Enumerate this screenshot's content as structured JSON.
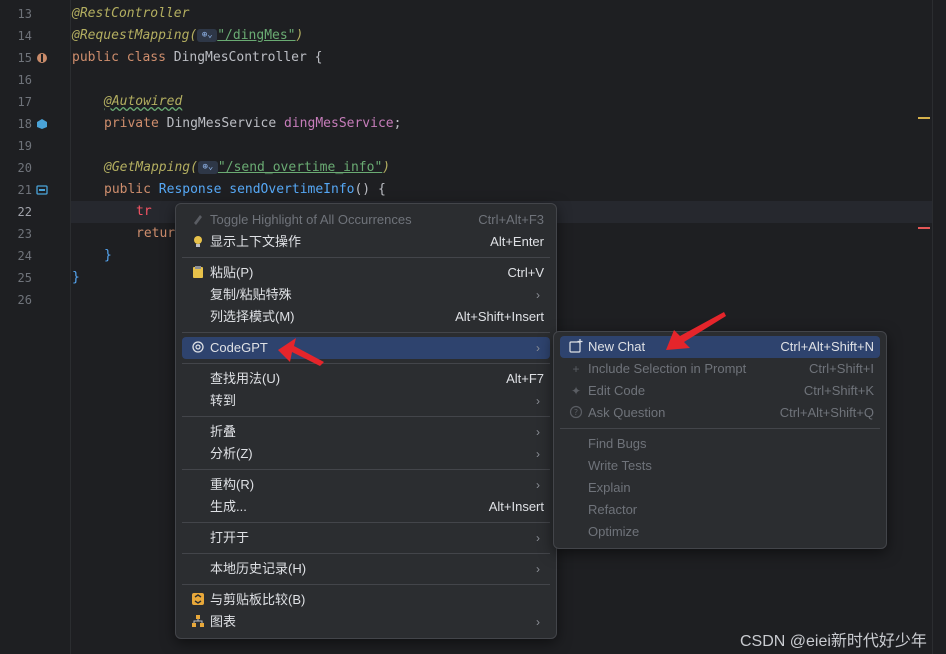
{
  "editor": {
    "line_numbers": [
      "13",
      "14",
      "15",
      "16",
      "17",
      "18",
      "19",
      "20",
      "21",
      "22",
      "23",
      "24",
      "25",
      "26"
    ],
    "code": {
      "l13_ann": "@RestController",
      "l14_ann": "@RequestMapping(",
      "l14_url": "\"/dingMes\"",
      "l14_close": ")",
      "l15_kw": "public class ",
      "l15_cls": "DingMesController {",
      "l17_ann": "@Autowired",
      "l18_kw": "private ",
      "l18_type": "DingMesService ",
      "l18_field": "dingMesService",
      "l18_end": ";",
      "l20_ann": "@GetMapping(",
      "l20_url": "\"/send_overtime_info\"",
      "l20_close": ")",
      "l21_kw": "public ",
      "l21_type": "Response ",
      "l21_fn": "sendOvertimeInfo",
      "l21_end": "() {",
      "l22_text": "tr",
      "l23_text": "retur",
      "l24_text": "}",
      "l25_text": "}"
    },
    "globe_icon_label": "⊕⌄"
  },
  "context_menu": {
    "items": [
      {
        "label": "Toggle Highlight of All Occurrences",
        "shortcut": "Ctrl+Alt+F3",
        "disabled": true
      },
      {
        "label": "显示上下文操作",
        "shortcut": "Alt+Enter",
        "icon": "bulb-icon"
      },
      {
        "label": "粘贴(P)",
        "shortcut": "Ctrl+V",
        "icon": "clipboard-icon"
      },
      {
        "label": "复制/粘贴特殊"
      },
      {
        "label": "列选择模式(M)",
        "shortcut": "Alt+Shift+Insert"
      },
      {
        "label": "CodeGPT",
        "icon": "codegpt-icon"
      },
      {
        "label": "查找用法(U)",
        "shortcut": "Alt+F7"
      },
      {
        "label": "转到"
      },
      {
        "label": "折叠"
      },
      {
        "label": "分析(Z)"
      },
      {
        "label": "重构(R)"
      },
      {
        "label": "生成...",
        "shortcut": "Alt+Insert"
      },
      {
        "label": "打开于"
      },
      {
        "label": "本地历史记录(H)"
      },
      {
        "label": "与剪贴板比较(B)",
        "icon": "compare-icon"
      },
      {
        "label": "图表",
        "icon": "diagram-icon"
      }
    ]
  },
  "codegpt_submenu": {
    "items": [
      {
        "label": "New Chat",
        "shortcut": "Ctrl+Alt+Shift+N"
      },
      {
        "label": "Include Selection in Prompt",
        "shortcut": "Ctrl+Shift+I"
      },
      {
        "label": "Edit Code",
        "shortcut": "Ctrl+Shift+K"
      },
      {
        "label": "Ask Question",
        "shortcut": "Ctrl+Alt+Shift+Q"
      },
      {
        "label": "Find Bugs"
      },
      {
        "label": "Write Tests"
      },
      {
        "label": "Explain"
      },
      {
        "label": "Refactor"
      },
      {
        "label": "Optimize"
      }
    ]
  },
  "watermark": "CSDN @eiei新时代好少年",
  "colors": {
    "background": "#1e1f22",
    "menu_bg": "#2b2d30",
    "selection": "#2e436e",
    "annotation_red_arrow": "#e5252b"
  }
}
